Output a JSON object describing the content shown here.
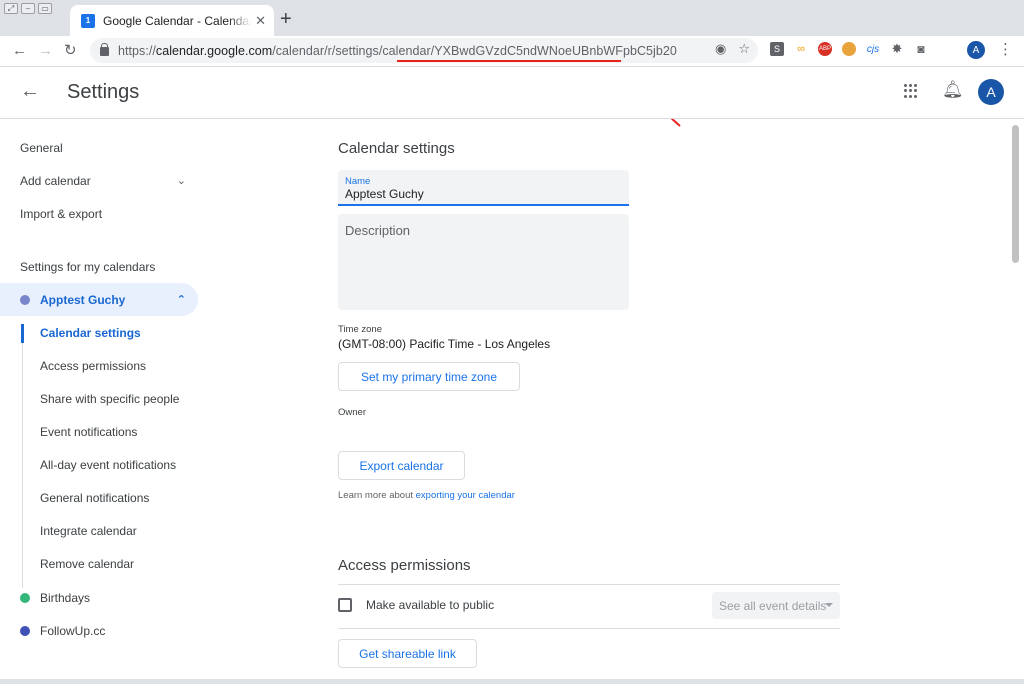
{
  "browser": {
    "tab_title": "Google Calendar - Calendar settings",
    "favicon_text": "1",
    "tab_close": "✕",
    "new_tab": "+",
    "url_scheme": "https://",
    "url_host": "calendar.google.com",
    "url_path_pre": "/calendar/r/settings/calendar/",
    "url_calendar_id": "YXBwdGVzdC5ndWNoeUBnbWFpbC5jb20",
    "profile_initial": "A",
    "ext_labels": [
      "S",
      "ABP",
      "cjs"
    ]
  },
  "header": {
    "title": "Settings",
    "avatar_initial": "A"
  },
  "sidebar": {
    "items": [
      {
        "label": "General"
      },
      {
        "label": "Add calendar"
      },
      {
        "label": "Import & export"
      }
    ],
    "section_title": "Settings for my calendars",
    "calendar": {
      "label": "Apptest Guchy",
      "color": "#7986cb"
    },
    "sub_items": [
      {
        "label": "Calendar settings"
      },
      {
        "label": "Access permissions"
      },
      {
        "label": "Share with specific people"
      },
      {
        "label": "Event notifications"
      },
      {
        "label": "All-day event notifications"
      },
      {
        "label": "General notifications"
      },
      {
        "label": "Integrate calendar"
      },
      {
        "label": "Remove calendar"
      }
    ],
    "other_calendars": [
      {
        "label": "Birthdays",
        "color": "#33b679"
      },
      {
        "label": "FollowUp.cc",
        "color": "#3f51b5"
      }
    ]
  },
  "main": {
    "section_title": "Calendar settings",
    "name_label": "Name",
    "name_value": "Apptest Guchy",
    "description_placeholder": "Description",
    "timezone_label": "Time zone",
    "timezone_value": "(GMT-08:00) Pacific Time - Los Angeles",
    "set_primary_tz_button": "Set my primary time zone",
    "owner_label": "Owner",
    "export_button": "Export calendar",
    "learn_more_text": "Learn more about ",
    "learn_more_link": "exporting your calendar",
    "access_title": "Access permissions",
    "public_label": "Make available to public",
    "visibility_select": "See all event details",
    "shareable_link_button": "Get shareable link"
  },
  "colors": {
    "accent": "#1a73e8",
    "annotation": "#e8231c"
  }
}
